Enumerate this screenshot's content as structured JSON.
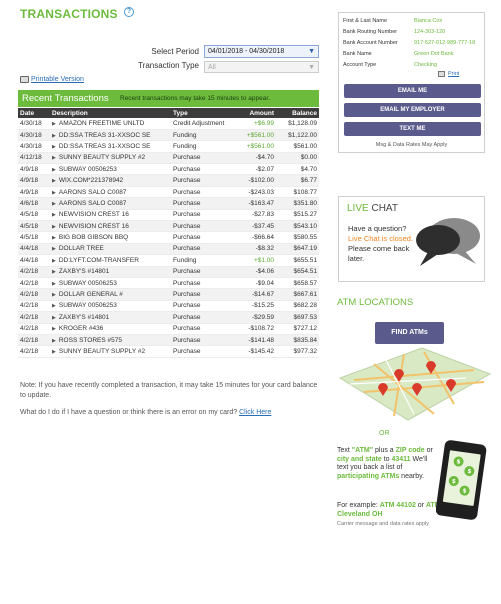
{
  "header": {
    "title": "TRANSACTIONS",
    "help_icon": "?"
  },
  "filters": {
    "period_label": "Select Period",
    "period_value": "04/01/2018 - 04/30/2018",
    "type_label": "Transaction Type",
    "type_value": "All"
  },
  "print_link": "Printable Version",
  "banner": {
    "title": "Recent Transactions",
    "note": "Recent transactions may take 15 minutes to appear."
  },
  "table": {
    "columns": [
      "Date",
      "Description",
      "Type",
      "Amount",
      "Balance"
    ],
    "rows": [
      [
        "4/30/18",
        "AMAZON FREETIME UNLTD",
        "Credit Adjustment",
        "+$6.99",
        "$1,128.09"
      ],
      [
        "4/30/18",
        "DD:SSA TREAS 31-XXSOC SE",
        "Funding",
        "+$561.00",
        "$1,122.00"
      ],
      [
        "4/30/18",
        "DD:SSA TREAS 31-XXSOC SE",
        "Funding",
        "+$561.00",
        "$561.00"
      ],
      [
        "4/12/18",
        "SUNNY BEAUTY SUPPLY #2",
        "Purchase",
        "-$4.70",
        "$0.00"
      ],
      [
        "4/9/18",
        "SUBWAY 00506253",
        "Purchase",
        "-$2.07",
        "$4.70"
      ],
      [
        "4/9/18",
        "WIX.COM*221378942",
        "Purchase",
        "-$102.00",
        "$6.77"
      ],
      [
        "4/9/18",
        "AARONS SALO C0087",
        "Purchase",
        "-$243.03",
        "$108.77"
      ],
      [
        "4/6/18",
        "AARONS SALO C0087",
        "Purchase",
        "-$163.47",
        "$351.80"
      ],
      [
        "4/5/18",
        "NEWVISION CREST 16",
        "Purchase",
        "-$27.83",
        "$515.27"
      ],
      [
        "4/5/18",
        "NEWVISION CREST 16",
        "Purchase",
        "-$37.45",
        "$543.10"
      ],
      [
        "4/5/18",
        "BIG BOB GIBSON BBQ",
        "Purchase",
        "-$66.64",
        "$580.55"
      ],
      [
        "4/4/18",
        "DOLLAR TREE",
        "Purchase",
        "-$8.32",
        "$647.19"
      ],
      [
        "4/4/18",
        "DD:LYFT.COM-TRANSFER",
        "Funding",
        "+$1.00",
        "$655.51"
      ],
      [
        "4/2/18",
        "ZAXBY'S #14801",
        "Purchase",
        "-$4.06",
        "$654.51"
      ],
      [
        "4/2/18",
        "SUBWAY 00506253",
        "Purchase",
        "-$9.04",
        "$658.57"
      ],
      [
        "4/2/18",
        "DOLLAR GENERAL #",
        "Purchase",
        "-$14.67",
        "$667.61"
      ],
      [
        "4/2/18",
        "SUBWAY 00506253",
        "Purchase",
        "-$15.25",
        "$682.28"
      ],
      [
        "4/2/18",
        "ZAXBY'S #14801",
        "Purchase",
        "-$29.59",
        "$697.53"
      ],
      [
        "4/2/18",
        "KROGER #436",
        "Purchase",
        "-$108.72",
        "$727.12"
      ],
      [
        "4/2/18",
        "ROSS STORES #575",
        "Purchase",
        "-$141.48",
        "$835.84"
      ],
      [
        "4/2/18",
        "SUNNY BEAUTY SUPPLY #2",
        "Purchase",
        "-$145.42",
        "$977.32"
      ]
    ]
  },
  "notes": {
    "balance_note": "Note: If you have recently completed a transaction, it may take 15 minutes for your card balance to update.",
    "question": "What do I do if I have a question or think there is an error on my card?",
    "question_link": "Click Here"
  },
  "account": {
    "rows": [
      {
        "label": "First & Last Name",
        "value": "Bianca Cox"
      },
      {
        "label": "Bank Routing Number",
        "value": "124-303-120"
      },
      {
        "label": "Bank Account Number",
        "value": "917-527-012-989-777-18"
      },
      {
        "label": "Bank Name",
        "value": "Green Dot Bank"
      },
      {
        "label": "Account Type",
        "value": "Checking"
      }
    ],
    "print": "Print",
    "buttons": [
      "EMAIL ME",
      "EMAIL MY EMPLOYER",
      "TEXT ME"
    ],
    "fees": "Msg & Data Rates May Apply"
  },
  "chat": {
    "live": "LIVE",
    "chat": "CHAT",
    "line1": "Have a question?",
    "closed": "Live Chat is closed.",
    "line2": "Please come back later."
  },
  "atm": {
    "title": "ATM LOCATIONS",
    "button": "FIND ATMs",
    "or": "OR",
    "sms_1": "Text ",
    "sms_atm": "\"ATM\"",
    "sms_2": " plus a ",
    "sms_zip": "ZIP code",
    "sms_3": " or ",
    "sms_city": "city and state",
    "sms_4": " to ",
    "sms_num": "43411",
    "sms_5": " We'll text you back a list of ",
    "sms_part": "participating ATMs",
    "sms_6": " nearby.",
    "ex_1": "For example: ",
    "ex_a": "ATM 44102",
    "ex_2": " or ",
    "ex_b": "ATM Cleveland OH",
    "small": "Carrier message and data rates apply"
  },
  "colors": {
    "brand_green": "#6cbb3c",
    "button_purple": "#5a5a8c",
    "chat_orange": "#f0841c"
  }
}
